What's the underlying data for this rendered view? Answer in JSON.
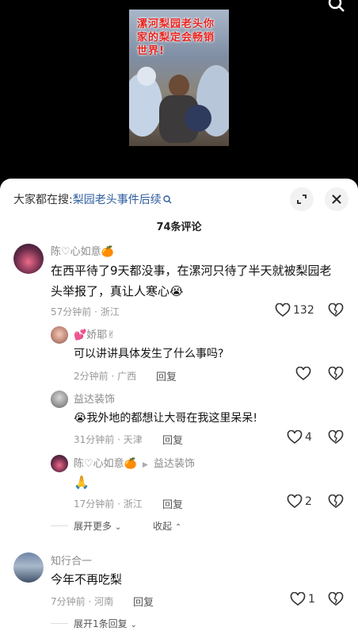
{
  "video": {
    "caption": "漯河梨园老头你家的梨定会畅销世界!"
  },
  "sheet": {
    "search_prefix": "大家都在搜:",
    "search_term": "梨园老头事件后续",
    "comment_count": "74条评论"
  },
  "comments": [
    {
      "user": "陈♡心如意🍊",
      "text_line1": "在西平待了9天都没事，在漯河只待了半天就被梨园老",
      "text_line2": "头举报了，真让人寒心😭",
      "time": "57分钟前 · 浙江",
      "likes": "132"
    },
    {
      "user": "💕娇耶✌",
      "text": "可以讲讲具体发生了什么事吗?",
      "time": "2分钟前 · 广西",
      "reply": "回复"
    },
    {
      "user": "益达装饰",
      "text": "😭我外地的都想让大哥在我这里呆呆!",
      "time": "31分钟前 · 天津",
      "reply": "回复",
      "likes": "4"
    },
    {
      "user": "陈♡心如意🍊",
      "reply_to": "益达装饰",
      "text": "🙏",
      "time": "17分钟前 · 浙江",
      "reply": "回复",
      "likes": "2"
    },
    {
      "user": "知行合一",
      "text": "今年不再吃梨",
      "time": "7分钟前 · 河南",
      "reply": "回复",
      "likes": "1"
    }
  ],
  "thread": {
    "expand_more": "展开更多",
    "collapse": "收起",
    "expand_one": "展开1条回复"
  },
  "colors": {
    "link": "#2f5c9e",
    "caption_red": "#e8231f"
  }
}
